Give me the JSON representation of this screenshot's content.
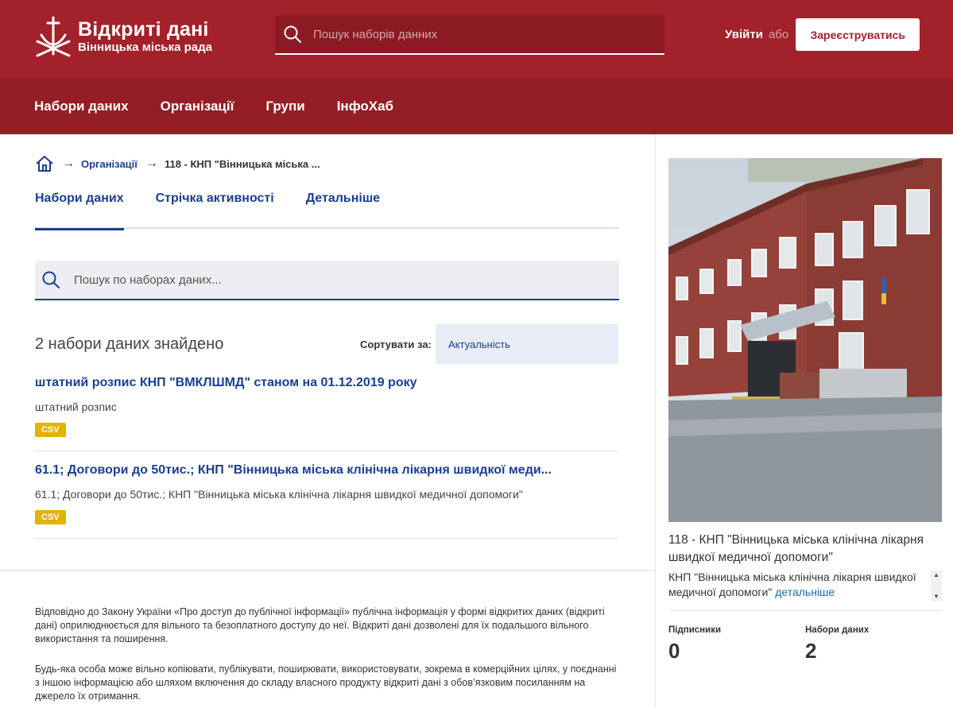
{
  "header": {
    "logo_title": "Відкриті дані",
    "logo_subtitle": "Вінницька міська рада",
    "search_placeholder": "Пошук наборів данних",
    "login_label": "Увійти",
    "or_label": "або",
    "register_label": "Зареєструватись"
  },
  "nav": {
    "items": [
      "Набори даних",
      "Організації",
      "Групи",
      "ІнфоХаб"
    ]
  },
  "breadcrumb": {
    "organizations": "Організації",
    "current": "118 - КНП \"Вінницька міська ..."
  },
  "tabs": {
    "items": [
      "Набори даних",
      "Стрічка активності",
      "Детальніше"
    ]
  },
  "search": {
    "placeholder": "Пошук по наборах даних..."
  },
  "results": {
    "count_label": "2 набори даних знайдено",
    "sort_label": "Сортувати за:",
    "sort_value": "Актуальність"
  },
  "datasets": [
    {
      "title": "штатний розпис КНП \"ВМКЛШМД\" станом на 01.12.2019 року",
      "description": "штатний розпис",
      "format": "CSV"
    },
    {
      "title": "61.1; Договори до 50тис.; КНП \"Вінницька міська клінічна лікарня швидкої меди...",
      "description": "61.1; Договори до 50тис.; КНП \"Вінницька міська клінічна лікарня швидкої медичної допомоги\"",
      "format": "CSV"
    }
  ],
  "footer": {
    "paragraph1": "Відповідно до Закону України «Про доступ до публічної інформації» публічна інформація у формі відкритих даних (відкриті дані) оприлюднюється для вільного та безоплатного доступу до неї. Відкриті дані дозволені для їх подальшого вільного використання та поширення.",
    "paragraph2": "Будь-яка особа може вільно копіювати, публікувати, поширювати, використовувати, зокрема в комерційних цілях, у поєднанні з іншою інформацією або шляхом включення до складу власного продукту відкриті дані з обов’язковим посиланням на джерело їх отримання."
  },
  "sidebar": {
    "org_name": "118 - КНП \"Вінницька міська клінічна лікарня швидкої медичної допомоги\"",
    "org_description": "КНП \"Вінницька міська клінічна лікарня швидкої медичної допомоги\"",
    "more_link": "детальніше",
    "followers_label": "Підписники",
    "followers_value": "0",
    "datasets_label": "Набори даних",
    "datasets_value": "2"
  },
  "colors": {
    "header_bg": "#a2212b",
    "nav_bg": "#951d26",
    "link_blue": "#1a3f8f",
    "badge_yellow": "#e0b400"
  }
}
